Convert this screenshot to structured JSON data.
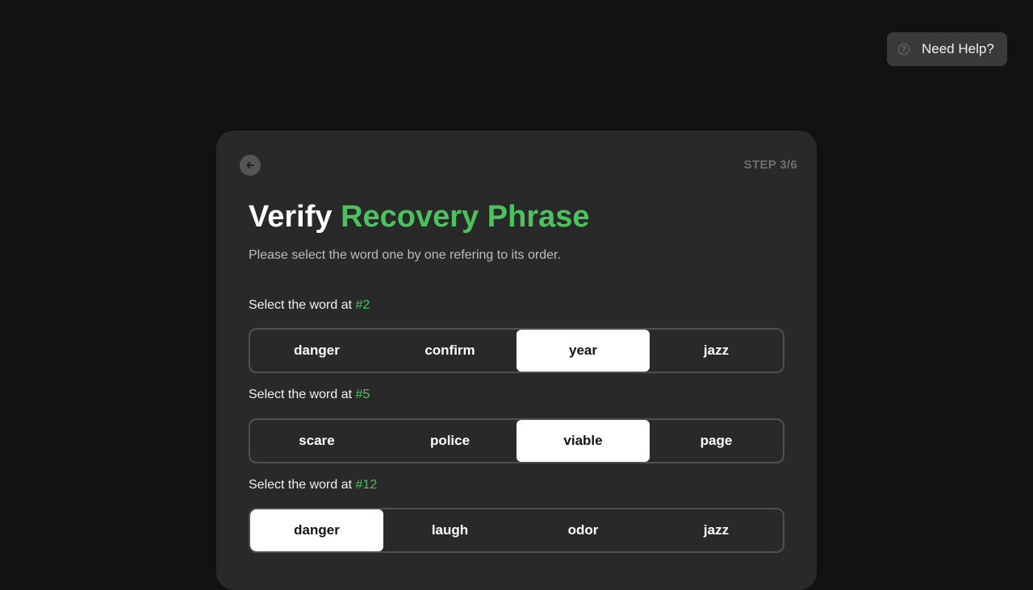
{
  "help": {
    "label": "Need Help?",
    "icon": "?"
  },
  "card": {
    "step": "STEP 3/6",
    "title_main": "Verify",
    "title_accent": "Recovery Phrase",
    "subtitle": "Please select the word one by one refering to its order.",
    "accent_color": "#4cc25e"
  },
  "questions": [
    {
      "prefix": "Select the word at",
      "number": "#2",
      "options": [
        "danger",
        "confirm",
        "year",
        "jazz"
      ],
      "selected_option": "year"
    },
    {
      "prefix": "Select the word at",
      "number": "#5",
      "options": [
        "scare",
        "police",
        "viable",
        "page"
      ],
      "selected_option": "viable"
    },
    {
      "prefix": "Select the word at",
      "number": "#12",
      "options": [
        "danger",
        "laugh",
        "odor",
        "jazz"
      ],
      "selected_option": "danger"
    }
  ]
}
